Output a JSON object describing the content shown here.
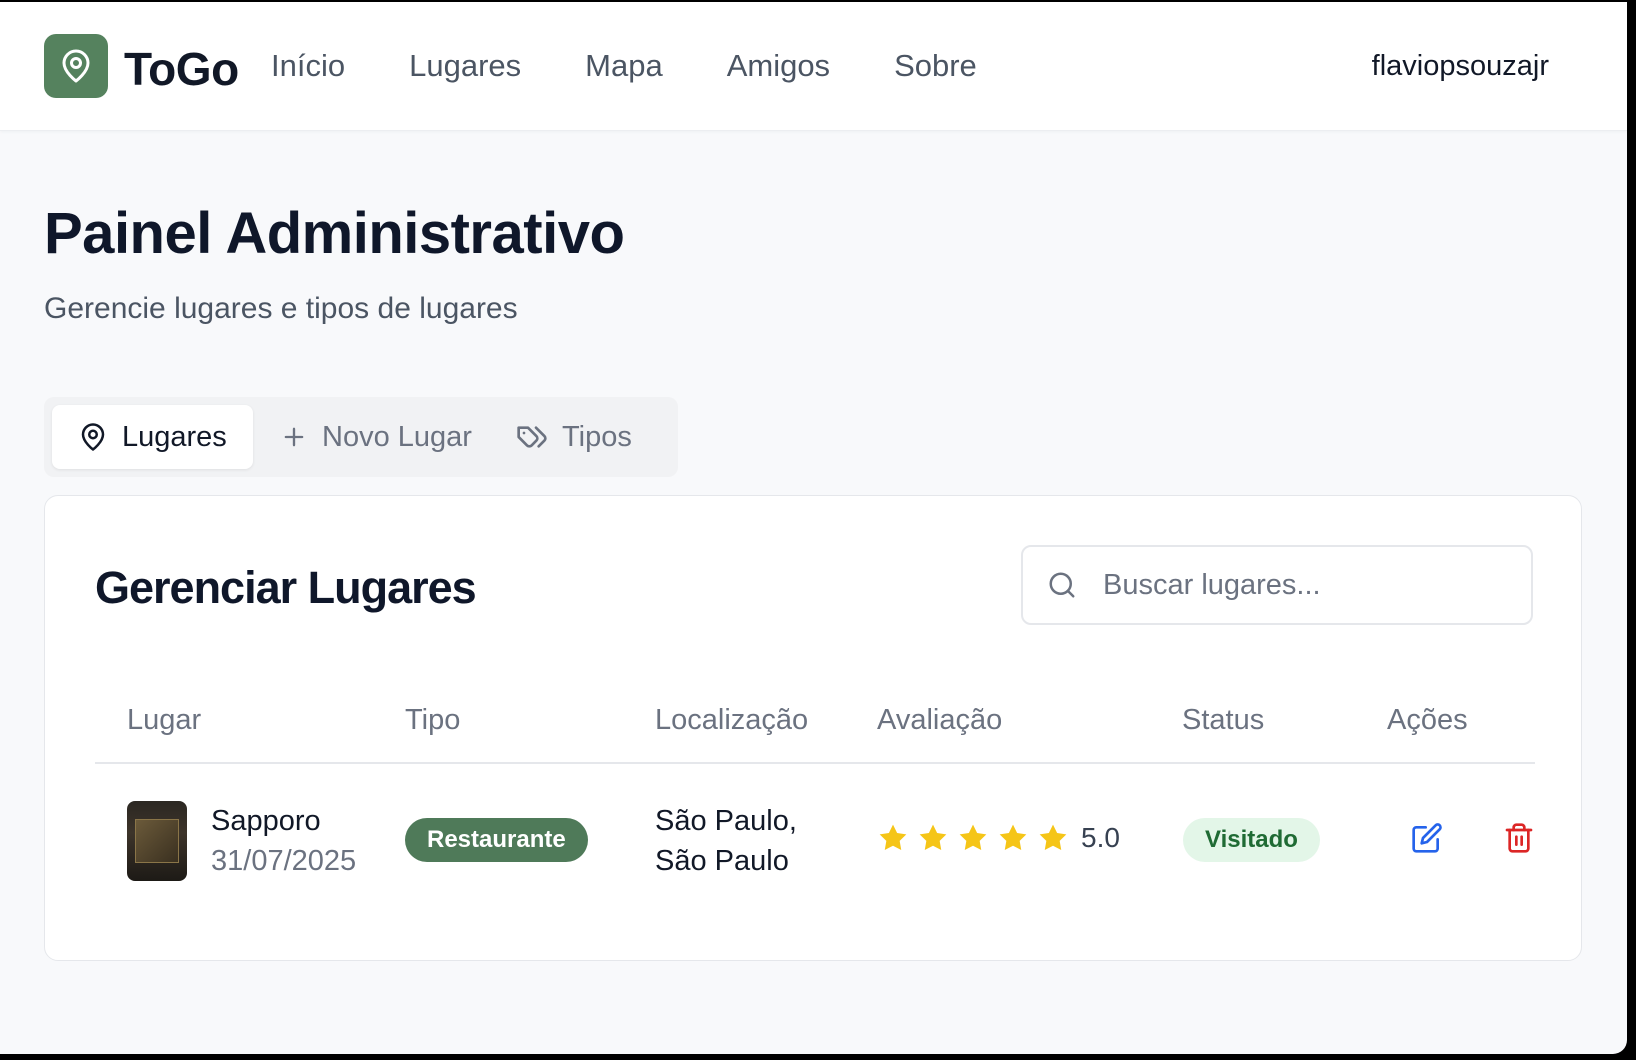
{
  "header": {
    "logo_text": "ToGo",
    "nav": [
      "Início",
      "Lugares",
      "Mapa",
      "Amigos",
      "Sobre"
    ],
    "username": "flaviopsouzajr"
  },
  "page": {
    "title": "Painel Administrativo",
    "subtitle": "Gerencie lugares e tipos de lugares"
  },
  "tabs": [
    {
      "label": "Lugares",
      "icon": "map-pin-icon",
      "active": true
    },
    {
      "label": "Novo Lugar",
      "icon": "plus-icon",
      "active": false
    },
    {
      "label": "Tipos",
      "icon": "tags-icon",
      "active": false
    }
  ],
  "card": {
    "title": "Gerenciar Lugares",
    "search_placeholder": "Buscar lugares..."
  },
  "table": {
    "columns": [
      "Lugar",
      "Tipo",
      "Localização",
      "Avaliação",
      "Status",
      "Ações"
    ],
    "rows": [
      {
        "name": "Sapporo",
        "date": "31/07/2025",
        "type": "Restaurante",
        "location_line1": "São Paulo,",
        "location_line2": "São Paulo",
        "rating": "5.0",
        "stars": 5,
        "status": "Visitado"
      }
    ]
  },
  "colors": {
    "brand": "#55825e",
    "star": "#f5c518",
    "edit": "#2563eb",
    "delete": "#dc2626",
    "status_bg": "#e3f6e8"
  }
}
